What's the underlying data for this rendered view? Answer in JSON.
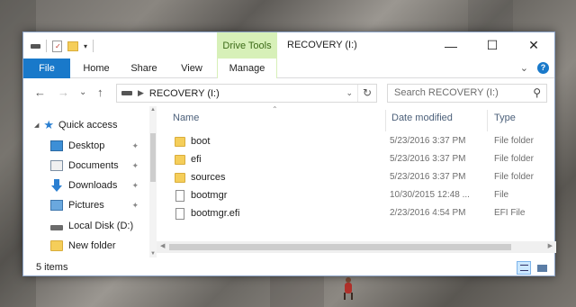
{
  "window": {
    "title": "RECOVERY (I:)",
    "contextual_tab": "Drive Tools",
    "controls": {
      "minimize": "—",
      "maximize": "☐",
      "close": "✕"
    }
  },
  "ribbon": {
    "tabs": [
      "File",
      "Home",
      "Share",
      "View",
      "Manage"
    ],
    "expand_glyph": "⌄",
    "help_glyph": "?"
  },
  "navigation": {
    "back": "←",
    "forward": "→",
    "recent": "⌄",
    "up": "↑",
    "breadcrumb": [
      "RECOVERY (I:)"
    ],
    "refresh": "↻",
    "search_placeholder": "Search RECOVERY (I:)"
  },
  "nav_pane": {
    "items": [
      {
        "label": "Quick access",
        "icon": "star-icon",
        "pinned": false
      },
      {
        "label": "Desktop",
        "icon": "desktop-icon",
        "pinned": true
      },
      {
        "label": "Documents",
        "icon": "documents-icon",
        "pinned": true
      },
      {
        "label": "Downloads",
        "icon": "downloads-icon",
        "pinned": true
      },
      {
        "label": "Pictures",
        "icon": "pictures-icon",
        "pinned": true
      },
      {
        "label": "Local Disk (D:)",
        "icon": "drive-icon",
        "pinned": false
      },
      {
        "label": "New folder",
        "icon": "folder-icon",
        "pinned": false
      }
    ],
    "pin_glyph": "📌"
  },
  "file_list": {
    "columns": [
      "Name",
      "Date modified",
      "Type"
    ],
    "rows": [
      {
        "name": "boot",
        "date": "5/23/2016 3:37 PM",
        "type": "File folder",
        "icon": "folder-icon"
      },
      {
        "name": "efi",
        "date": "5/23/2016 3:37 PM",
        "type": "File folder",
        "icon": "folder-icon"
      },
      {
        "name": "sources",
        "date": "5/23/2016 3:37 PM",
        "type": "File folder",
        "icon": "folder-icon"
      },
      {
        "name": "bootmgr",
        "date": "10/30/2015 12:48 ...",
        "type": "File",
        "icon": "file-icon"
      },
      {
        "name": "bootmgr.efi",
        "date": "2/23/2016 4:54 PM",
        "type": "EFI File",
        "icon": "file-icon"
      }
    ]
  },
  "status": {
    "item_count": "5 items"
  },
  "colors": {
    "accent": "#1979ca",
    "drive_tools": "#d7f0b8",
    "folder": "#f5ce5a"
  }
}
